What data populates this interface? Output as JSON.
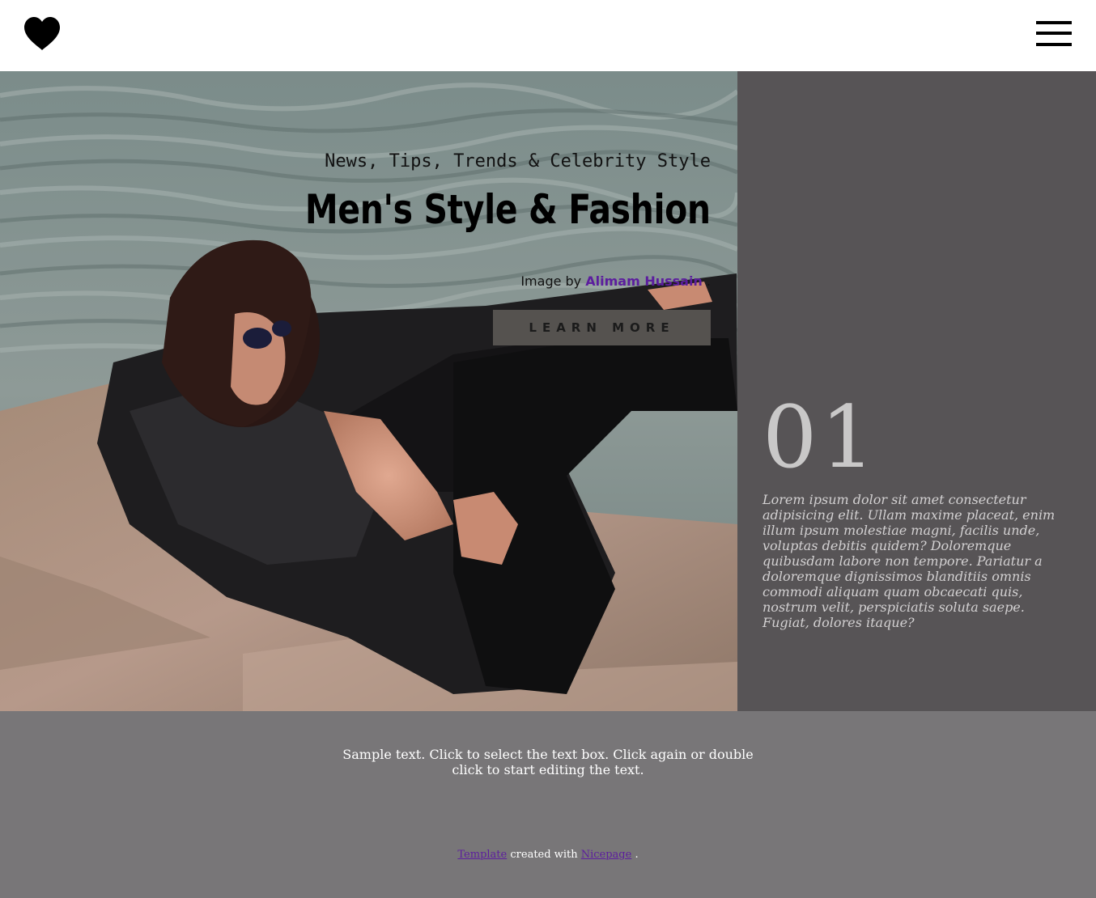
{
  "header": {
    "logo_icon": "heart-icon",
    "menu_icon": "hamburger-icon"
  },
  "hero": {
    "subtitle": "News, Tips, Trends & Celebrity Style",
    "title": "Men's Style & Fashion",
    "credit_prefix": "Image by",
    "credit_author": "Alimam Hussain",
    "credit_suffix": ".",
    "button_label": "LEARN MORE"
  },
  "panel": {
    "number": "01",
    "text": "Lorem ipsum dolor sit amet consectetur adipisicing elit. Ullam maxime placeat, enim illum ipsum molestiae magni, facilis unde, voluptas debitis quidem? Doloremque quibusdam labore non tempore. Pariatur a doloremque dignissimos blanditiis omnis commodi aliquam quam obcaecati quis, nostrum velit, perspiciatis soluta saepe. Fugiat, dolores itaque?"
  },
  "bottom": {
    "sample_text": "Sample text. Click to select the text box. Click again or double click to start editing the text.",
    "footer_template": "Template",
    "footer_middle": "created with",
    "footer_nicepage": "Nicepage",
    "footer_end": "."
  },
  "colors": {
    "panel_bg": "#575456",
    "bottom_bg": "#787678",
    "link": "#5c1d9e",
    "button_bg": "#55524f"
  }
}
